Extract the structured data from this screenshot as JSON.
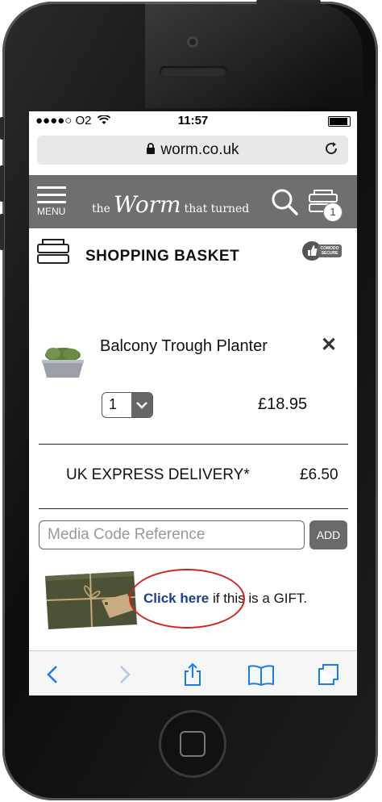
{
  "statusbar": {
    "carrier": "●●●●○ O2",
    "time": "11:57"
  },
  "browser": {
    "url": "worm.co.uk"
  },
  "site_header": {
    "menu_label": "MENU",
    "logo_the": "the",
    "logo_worm": "Worm",
    "logo_turned": "that turned",
    "cart_count": "1"
  },
  "basket": {
    "title": "SHOPPING BASKET",
    "secure_badge": "COMODO SECURE"
  },
  "item": {
    "name": "Balcony Trough Planter",
    "quantity": "1",
    "price": "£18.95",
    "remove_symbol": "✕"
  },
  "delivery": {
    "label": "UK EXPRESS DELIVERY*",
    "price": "£6.50"
  },
  "media_code": {
    "placeholder": "Media Code Reference",
    "add_label": "ADD"
  },
  "gift": {
    "link_text": "Click here",
    "rest_text": " if this is a GIFT."
  },
  "colors": {
    "header_bg": "#6f6f6f",
    "link_blue": "#1a3f8f",
    "ios_blue": "#1a7cf0",
    "highlight_red": "#d42020"
  },
  "toolbar_icons": [
    "back-icon",
    "forward-icon",
    "share-icon",
    "bookmarks-icon",
    "tabs-icon"
  ]
}
